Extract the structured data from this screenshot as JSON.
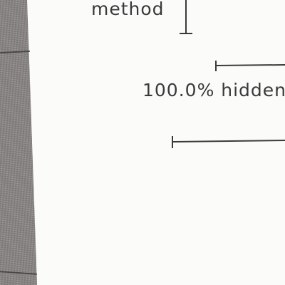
{
  "labels": {
    "method": "method",
    "hidden": "100.0% hidden"
  }
}
